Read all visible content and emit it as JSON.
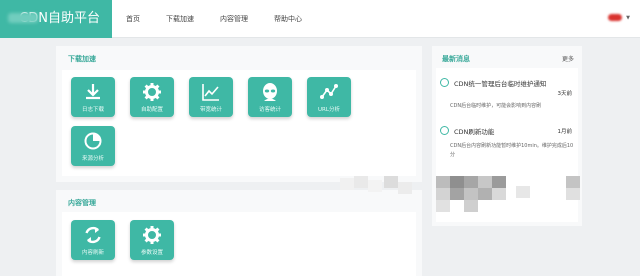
{
  "header": {
    "brand": "CDN自助平台",
    "nav": [
      "首页",
      "下载加速",
      "内容管理",
      "帮助中心"
    ]
  },
  "download": {
    "title": "下载加速",
    "tiles": [
      "日志下载",
      "自助配置",
      "带宽统计",
      "访客统计",
      "URL分析",
      "来源分析"
    ]
  },
  "content": {
    "title": "内容管理",
    "tiles": [
      "内容刷新",
      "参数设置"
    ]
  },
  "news": {
    "title": "最新消息",
    "more": "更多",
    "items": [
      {
        "title": "CDN统一管理后台临时维护通知",
        "time": "3天前",
        "desc": "CDN后台临时维护，可能会影响到内容刷"
      },
      {
        "title": "CDN刷新功能",
        "time": "1月前",
        "desc": "CDN后台内容刷新功能暂时维护10min。维护完成后10分"
      }
    ]
  },
  "colors": {
    "accent": "#3fb8a5",
    "panel": "#f8f9fa",
    "background": "#eef0f2"
  },
  "icons": [
    "download-icon",
    "gear-icon",
    "line-chart-icon",
    "alien-icon",
    "url-graph-icon",
    "pie-icon",
    "refresh-icon",
    "gear-icon"
  ]
}
